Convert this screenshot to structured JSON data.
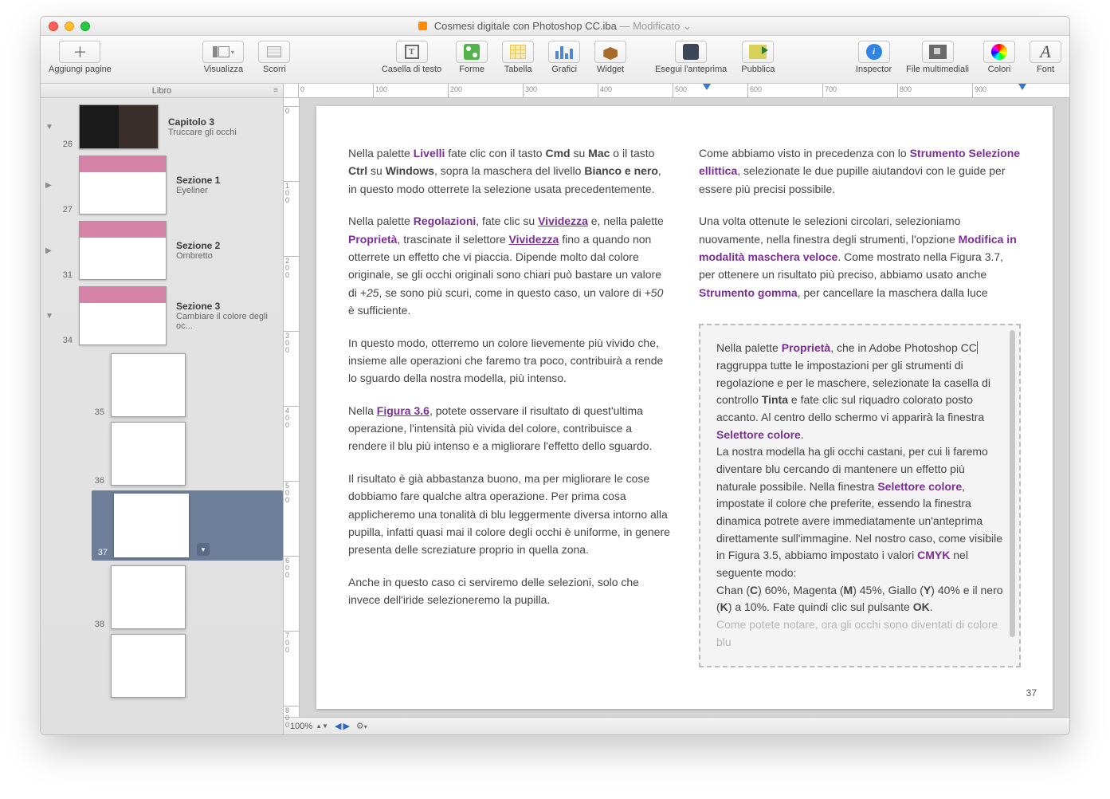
{
  "window": {
    "filename": "Cosmesi digitale con Photoshop CC.iba",
    "status": "Modificato"
  },
  "toolbar": {
    "add_pages": "Aggiungi pagine",
    "view": "Visualizza",
    "scroll": "Scorri",
    "textbox": "Casella di testo",
    "shapes": "Forme",
    "table": "Tabella",
    "charts": "Grafici",
    "widget": "Widget",
    "preview": "Esegui l'anteprima",
    "publish": "Pubblica",
    "inspector": "Inspector",
    "media": "File multimediali",
    "colors": "Colori",
    "font": "Font"
  },
  "sidebar": {
    "header": "Libro",
    "chapter": {
      "title": "Capitolo 3",
      "subtitle": "Truccare gli occhi",
      "page": "26"
    },
    "sections": [
      {
        "title": "Sezione 1",
        "subtitle": "Eyeliner",
        "page": "27"
      },
      {
        "title": "Sezione 2",
        "subtitle": "Ombretto",
        "page": "31"
      },
      {
        "title": "Sezione 3",
        "subtitle": "Cambiare il colore degli oc...",
        "page": "34"
      }
    ],
    "pages": [
      {
        "num": "35"
      },
      {
        "num": "36"
      },
      {
        "num": "37",
        "selected": true
      },
      {
        "num": "38"
      },
      {
        "num": ""
      }
    ]
  },
  "ruler": {
    "h": [
      "0",
      "100",
      "200",
      "300",
      "400",
      "500",
      "600",
      "700",
      "800",
      "900"
    ],
    "v": [
      "0",
      "100",
      "200",
      "300",
      "400",
      "500",
      "600",
      "700",
      "800"
    ]
  },
  "doc": {
    "left": {
      "p1a": "Nella palette ",
      "p1_livelli": "Livelli",
      "p1b": " fate clic con il tasto ",
      "p1_cmd": "Cmd",
      "p1c": " su ",
      "p1_mac": "Mac",
      "p1d": " o il tasto ",
      "p1_ctrl": "Ctrl",
      "p1e": " su ",
      "p1_win": "Windows",
      "p1f": ", sopra la maschera del livello ",
      "p1_bn": "Bianco e nero",
      "p1g": ", in questo modo otterrete la selezione usata precedentemente.",
      "p2a": "Nella palette ",
      "p2_reg": "Regolazioni",
      "p2b": ", fate clic su ",
      "p2_viv1": "Vividezza",
      "p2c": " e, nella palette ",
      "p2_prop": "Proprietà",
      "p2d": ", trascinate il selettore ",
      "p2_viv2": "Vividezza",
      "p2e": "  fino a quando non otterrete un effetto che vi piaccia. Dipende molto dal colore originale, se gli occhi originali sono chiari può bastare un valore di ",
      "p2_v25": "+25",
      "p2f": ", se sono più scuri, come in questo caso, un valore di ",
      "p2_v50": "+50",
      "p2g": " è sufficiente.",
      "p3": "In questo modo, otterremo un colore lievemente più vivido che, insieme alle operazioni che faremo tra poco, contribuirà a rende lo sguardo della nostra modella, più intenso.",
      "p4a": "Nella ",
      "p4_fig": "Figura 3.6",
      "p4b": ", potete osservare il risultato di quest'ultima operazione, l'intensità più vivida del colore, contribuisce a rendere il blu più intenso e a migliorare l'effetto dello sguardo.",
      "p5": "Il risultato è già abbastanza buono, ma per migliorare le cose dobbiamo fare qualche altra operazione. Per prima cosa applicheremo una tonalità di blu leggermente diversa intorno alla pupilla, infatti quasi mai il colore degli occhi è uniforme, in genere presenta delle screziature proprio in quella zona.",
      "p6": "Anche in questo caso ci serviremo delle selezioni, solo che invece dell'iride selezioneremo la pupilla."
    },
    "right": {
      "p1a": "Come abbiamo visto in precedenza con lo ",
      "p1_sel": "Strumento Selezione ellittica",
      "p1b": ", selezionate le due pupille aiutandovi con le guide per essere più precisi possibile.",
      "p2a": "Una volta ottenute le selezioni circolari, selezioniamo nuovamente, nella finestra degli strumenti, l'opzione ",
      "p2_mod": "Modifica in modalità maschera veloce",
      "p2b": ". Come mostrato nella Figura 3.7, per ottenere un risultato più preciso, abbiamo usato anche ",
      "p2_gom": "Strumento gomma",
      "p2c": ", per cancellare la maschera dalla luce",
      "c1a": "Nella palette ",
      "c1_prop": "Proprietà",
      "c1b": ", che in Adobe Photoshop CC",
      "c1c": " raggruppa tutte le impostazioni per gli strumenti di regolazione e per le maschere, selezionate la casella di controllo ",
      "c1_tinta": "Tinta",
      "c1d": " e fate clic sul riquadro colorato posto accanto. Al centro dello schermo vi apparirà la finestra ",
      "c1_selcol": "Selettore colore",
      "c1e": ".",
      "c2a": "La nostra modella ha gli occhi castani, per cui li faremo diventare blu cercando di mantenere un effetto più naturale possibile. Nella finestra ",
      "c2_selcol": "Selettore colore",
      "c2b": ", impostate il colore che preferite, essendo la finestra dinamica potrete avere immediatamente un'anteprima direttamente sull'immagine. Nel nostro caso, come visibile in Figura 3.5, abbiamo impostato i valori ",
      "c2_cmyk": "CMYK",
      "c2c": " nel seguente modo:",
      "c3a": "Chan (",
      "c3_c": "C",
      "c3b": ") 60%, Magenta (",
      "c3_m": "M",
      "c3c": ") 45%, Giallo (",
      "c3_y": "Y",
      "c3d": ") 40% e il nero (",
      "c3_k": "K",
      "c3e": ") a 10%. Fate quindi clic sul pulsante ",
      "c3_ok": "OK",
      "c3f": ".",
      "c4": "Come potete notare, ora gli occhi sono diventati di colore blu"
    },
    "page_number": "37"
  },
  "status": {
    "zoom": "100%"
  }
}
